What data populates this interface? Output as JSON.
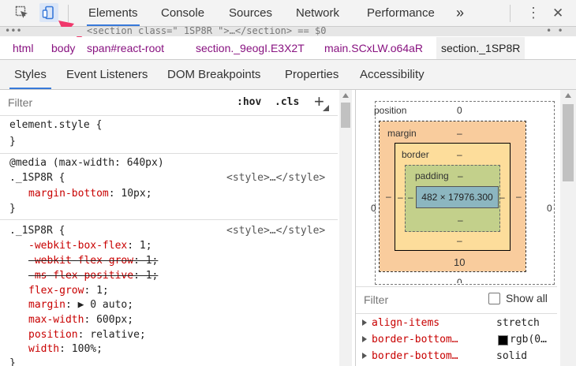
{
  "toolbar": {
    "tabs": [
      {
        "label": "Elements",
        "active": true
      },
      {
        "label": "Console",
        "active": false
      },
      {
        "label": "Sources",
        "active": false
      },
      {
        "label": "Network",
        "active": false
      },
      {
        "label": "Performance",
        "active": false
      }
    ],
    "more_label": "»",
    "menu_label": "⋮",
    "close_label": "✕",
    "icons": [
      "inspect-icon",
      "device-toolbar-icon"
    ]
  },
  "source_line": {
    "left_dots": "•••",
    "text": "<section class=\" 1SP8R  \">…</section> == $0",
    "right_dots": "• •"
  },
  "breadcrumbs": [
    {
      "label": "html"
    },
    {
      "label": "body"
    },
    {
      "label": "span#react-root"
    },
    {
      "label": "section._9eogI.E3X2T"
    },
    {
      "label": "main.SCxLW.o64aR"
    },
    {
      "label": "section._1SP8R"
    }
  ],
  "subtabs": [
    {
      "label": "Styles",
      "active": true
    },
    {
      "label": "Event Listeners",
      "active": false
    },
    {
      "label": "DOM Breakpoints",
      "active": false
    },
    {
      "label": "Properties",
      "active": false
    },
    {
      "label": "Accessibility",
      "active": false
    }
  ],
  "styles": {
    "filter_placeholder": "Filter",
    "hov_label": ":hov",
    "cls_label": ".cls",
    "add_label": "+",
    "element_style": {
      "selector": "element.style {",
      "close": "}"
    },
    "media_rule": {
      "media": "@media (max-width: 640px)",
      "selector": "._1SP8R {",
      "origin": "<style>…</style>",
      "prop": "margin-bottom",
      "value": ": 10px;",
      "close": "}"
    },
    "main_rule": {
      "selector": "._1SP8R {",
      "origin": "<style>…</style>",
      "props": [
        {
          "name": "-webkit-box-flex",
          "value": ": 1;",
          "strike": false
        },
        {
          "name": "-webkit-flex-grow",
          "value": ": 1;",
          "strike": true
        },
        {
          "name": "-ms-flex-positive",
          "value": ": 1;",
          "strike": true
        },
        {
          "name": "flex-grow",
          "value": ": 1;",
          "strike": false
        },
        {
          "name": "margin",
          "value": ": ▶ 0 auto;",
          "strike": false
        },
        {
          "name": "max-width",
          "value": ": 600px;",
          "strike": false
        },
        {
          "name": "position",
          "value": ": relative;",
          "strike": false
        },
        {
          "name": "width",
          "value": ": 100%;",
          "strike": false
        }
      ],
      "close": "}"
    }
  },
  "box_model": {
    "position_label": "position",
    "position_value": "0",
    "margin_label": "margin",
    "margin_top": "–",
    "margin_bottom": "10",
    "margin_left": "–",
    "margin_right": "–",
    "border_label": "border",
    "border_value": "–",
    "border_bottom": "–",
    "border_left": "–",
    "border_right": "–",
    "padding_label": "padding",
    "padding_value": "–",
    "padding_bottom": "–",
    "padding_left": "–",
    "padding_right": "–",
    "content": "482 × 17976.300",
    "pos_left": "0",
    "pos_right": "0",
    "pos_bottom": "0",
    "colors": {
      "margin": "#f9cc9d",
      "border": "#fddd9b",
      "padding": "#c3d08b",
      "content": "#8cb6c0"
    }
  },
  "computed": {
    "filter_placeholder": "Filter",
    "show_all_label": "Show all",
    "rows": [
      {
        "name": "align-items",
        "value": "stretch"
      },
      {
        "name": "border-bottom…",
        "value": "rgb(0…"
      },
      {
        "name": "border-bottom…",
        "value": "solid"
      }
    ]
  }
}
